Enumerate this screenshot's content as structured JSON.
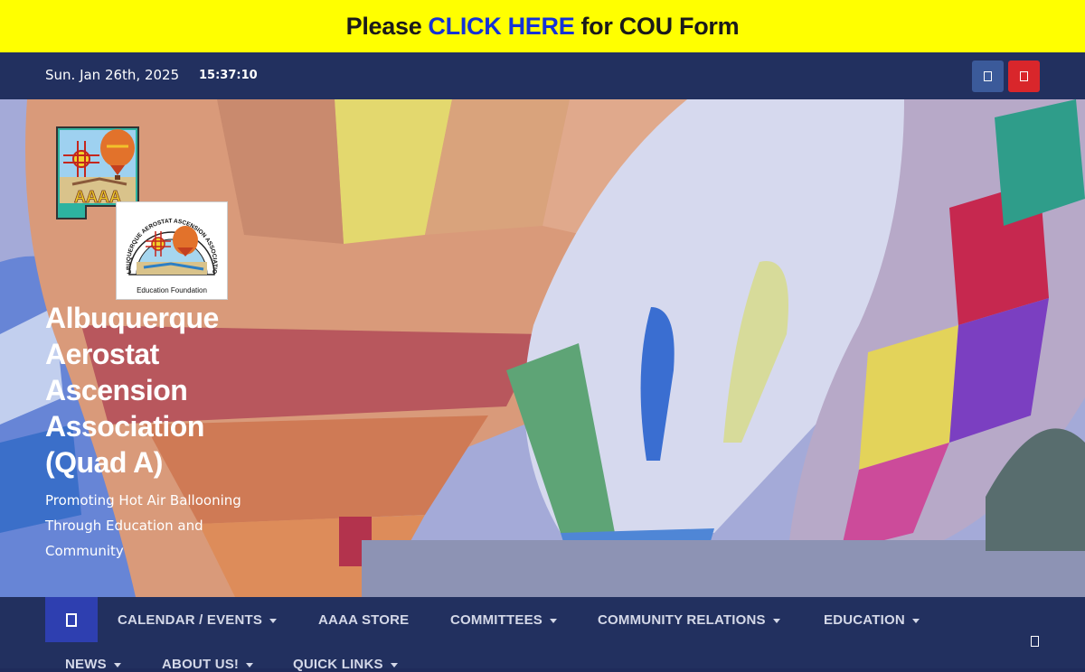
{
  "announcement": {
    "before": "Please",
    "link": "CLICK HERE",
    "after": "for COU Form"
  },
  "topbar": {
    "date": "Sun. Jan 26th, 2025",
    "time": "15:37:10",
    "social": [
      {
        "name": "facebook-icon",
        "color": "#3b5a9a"
      },
      {
        "name": "youtube-icon",
        "color": "#d9262b"
      }
    ]
  },
  "hero": {
    "logo_primary_text": "AAAA",
    "logo_seal_ring_text": "ALBUQUERQUE AEROSTAT ASCENSION ASSOCIATION",
    "logo_seal_caption": "Education Foundation",
    "title": "Albuquerque Aerostat Ascension Association (Quad A)",
    "tagline": "Promoting Hot Air Ballooning Through Education and Community"
  },
  "nav": {
    "items": [
      {
        "label": "CALENDAR / EVENTS",
        "dropdown": true
      },
      {
        "label": "AAAA STORE",
        "dropdown": false
      },
      {
        "label": "COMMITTEES",
        "dropdown": true
      },
      {
        "label": "COMMUNITY RELATIONS",
        "dropdown": true
      },
      {
        "label": "EDUCATION",
        "dropdown": true
      },
      {
        "label": "NEWS",
        "dropdown": true
      },
      {
        "label": "ABOUT US!",
        "dropdown": true
      },
      {
        "label": "QUICK LINKS",
        "dropdown": true
      }
    ]
  },
  "colors": {
    "announce_bg": "#ffff00",
    "link": "#1432d6",
    "navy": "#22305f",
    "home_button": "#2e3fb0"
  }
}
